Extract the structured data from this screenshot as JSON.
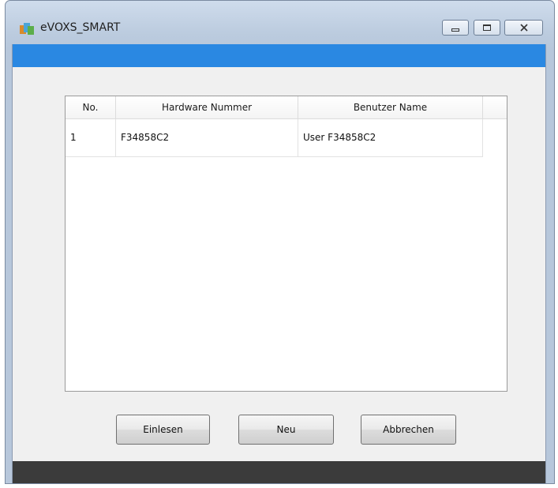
{
  "window": {
    "title": "eVOXS_SMART",
    "icon": "app-icon",
    "controls": {
      "minimize": "minimize-icon",
      "maximize": "maximize-icon",
      "close": "close-icon"
    }
  },
  "colors": {
    "accent_bar": "#2a88e2",
    "status_bar": "#3b3b3b",
    "client_bg": "#f0f0f0"
  },
  "table": {
    "columns": [
      "No.",
      "Hardware Nummer",
      "Benutzer Name"
    ],
    "rows": [
      {
        "no": "1",
        "hardware": "F34858C2",
        "user": "User F34858C2"
      }
    ]
  },
  "buttons": {
    "read": "Einlesen",
    "new": "Neu",
    "cancel": "Abbrechen"
  }
}
